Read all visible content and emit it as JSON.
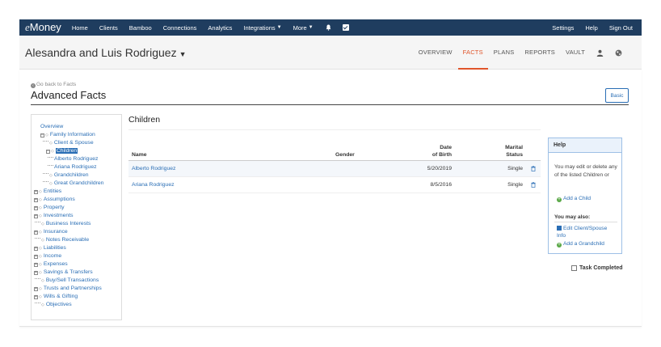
{
  "app": {
    "logo_prefix": "e",
    "logo_name": "Money"
  },
  "topnav": {
    "items": [
      {
        "label": "Home"
      },
      {
        "label": "Clients"
      },
      {
        "label": "Bamboo"
      },
      {
        "label": "Connections"
      },
      {
        "label": "Analytics"
      },
      {
        "label": "Integrations"
      },
      {
        "label": "More"
      }
    ],
    "right": [
      {
        "label": "Settings"
      },
      {
        "label": "Help"
      },
      {
        "label": "Sign Out"
      }
    ],
    "icons": [
      "bell-icon",
      "checkbox-icon"
    ]
  },
  "client": {
    "name": "Alesandra and Luis Rodriguez",
    "tabs": [
      {
        "label": "OVERVIEW",
        "active": false
      },
      {
        "label": "FACTS",
        "active": true
      },
      {
        "label": "PLANS",
        "active": false
      },
      {
        "label": "REPORTS",
        "active": false
      },
      {
        "label": "VAULT",
        "active": false
      }
    ],
    "accent_color": "#e0552a"
  },
  "page": {
    "back_link": "Go back to Facts",
    "title": "Advanced Facts",
    "basic_button": "Basic"
  },
  "tree": {
    "items": [
      {
        "label": "Overview"
      },
      {
        "label": "Family Information"
      },
      {
        "label": "Client & Spouse"
      },
      {
        "label": "Children",
        "selected": true
      },
      {
        "label": "Alberto Rodriguez"
      },
      {
        "label": "Ariana Rodriguez"
      },
      {
        "label": "Grandchildren"
      },
      {
        "label": "Great Grandchildren"
      },
      {
        "label": "Entities"
      },
      {
        "label": "Assumptions"
      },
      {
        "label": "Property"
      },
      {
        "label": "Investments"
      },
      {
        "label": "Business Interests"
      },
      {
        "label": "Insurance"
      },
      {
        "label": "Notes Receivable"
      },
      {
        "label": "Liabilities"
      },
      {
        "label": "Income"
      },
      {
        "label": "Expenses"
      },
      {
        "label": "Savings & Transfers"
      },
      {
        "label": "Buy/Sell Transactions"
      },
      {
        "label": "Trusts and Partnerships"
      },
      {
        "label": "Wills & Gifting"
      },
      {
        "label": "Objectives"
      }
    ]
  },
  "children": {
    "title": "Children",
    "columns": {
      "name": "Name",
      "gender": "Gender",
      "dob_line1": "Date",
      "dob_line2": "of Birth",
      "marital_line1": "Marital",
      "marital_line2": "Status"
    },
    "rows": [
      {
        "name": "Alberto Rodriguez",
        "gender": "",
        "dob": "5/20/2019",
        "marital": "Single"
      },
      {
        "name": "Ariana Rodriguez",
        "gender": "",
        "dob": "8/5/2016",
        "marital": "Single"
      }
    ]
  },
  "help": {
    "title": "Help",
    "text": "You may edit or delete any of the listed Children or",
    "add_child": "Add a Child",
    "also_heading": "You may also:",
    "edit_client": "Edit Client/Spouse Info",
    "add_grandchild": "Add a Grandchild"
  },
  "task": {
    "label": "Task Completed",
    "checked": false
  }
}
